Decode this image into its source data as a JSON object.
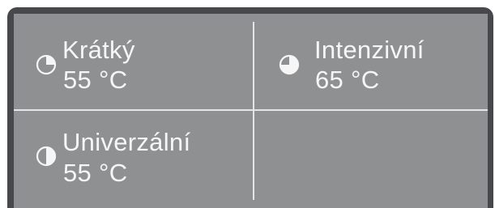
{
  "programs": [
    {
      "name": "Krátký",
      "temperature": "55 °C",
      "icon": "pie-quarter-icon"
    },
    {
      "name": "Intenzivní",
      "temperature": "65 °C",
      "icon": "pie-three-quarter-icon"
    },
    {
      "name": "Univerzální",
      "temperature": "55 °C",
      "icon": "pie-half-icon"
    }
  ],
  "colors": {
    "frame": "#46484b",
    "panel": "#8f9092",
    "text": "#f6f6f6",
    "divider": "#e4e5e6"
  }
}
